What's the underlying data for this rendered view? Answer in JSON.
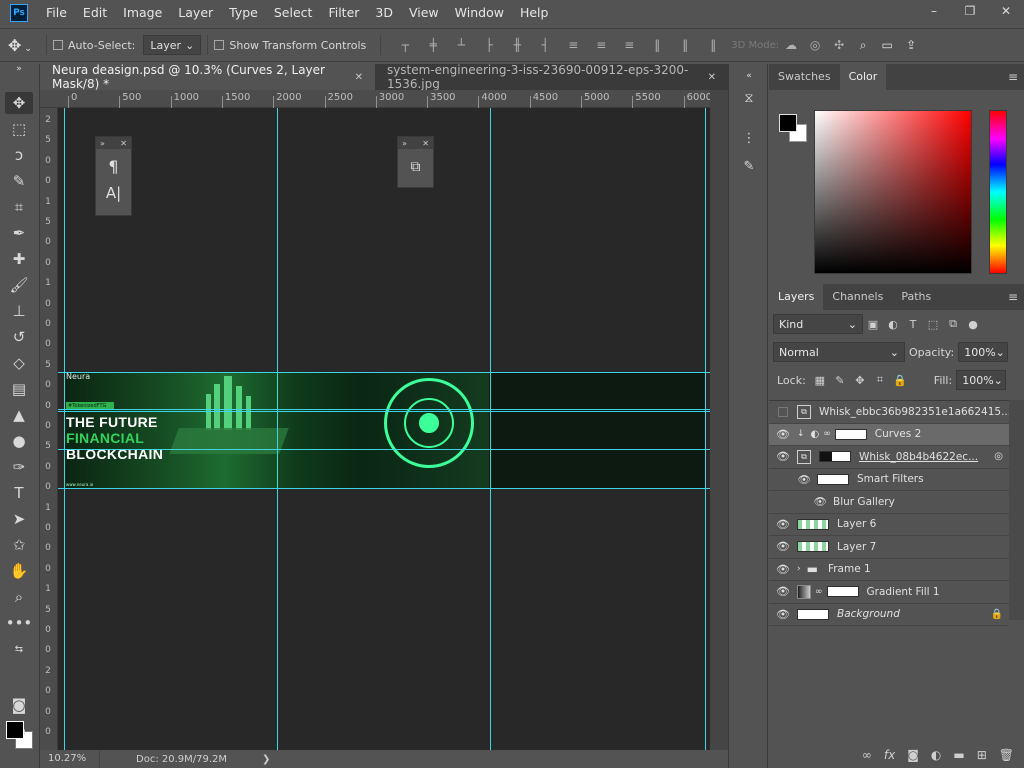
{
  "app": {
    "logo": "Ps"
  },
  "menu": [
    "File",
    "Edit",
    "Image",
    "Layer",
    "Type",
    "Select",
    "Filter",
    "3D",
    "View",
    "Window",
    "Help"
  ],
  "window_controls": {
    "minimize": "–",
    "restore": "❐",
    "close": "✕"
  },
  "options": {
    "auto_select_label": "Auto-Select:",
    "auto_select_value": "Layer",
    "transform_label": "Show Transform Controls",
    "mode_3d": "3D Mode:"
  },
  "tabs": [
    {
      "label": "Neura deasign.psd @ 10.3% (Curves 2, Layer Mask/8) *",
      "close": "✕"
    },
    {
      "label": "system-engineering-3-iss-23690-00912-eps-3200-1536.jpg",
      "close": "✕"
    }
  ],
  "ruler_top": [
    "0",
    "500",
    "1000",
    "1500",
    "2000",
    "2500",
    "3000",
    "3500",
    "4000",
    "4500",
    "5000",
    "5500",
    "6000"
  ],
  "ruler_left": [
    "2",
    "5",
    "0",
    "0",
    "1",
    "5",
    "0",
    "0",
    "1",
    "0",
    "0",
    "0",
    "5",
    "0",
    "0",
    "0",
    "5",
    "0",
    "0",
    "1",
    "0",
    "0",
    "0",
    "1",
    "5",
    "0",
    "0",
    "2",
    "0",
    "0",
    "0"
  ],
  "banner": {
    "logo": "Neura",
    "tag": "#TokenizedFTG",
    "line1": "THE FUTURE",
    "line2": "FINANCIAL",
    "line3": "BLOCKCHAIN",
    "small": "www.neura.io"
  },
  "float_panel_1": {
    "icon1": "¶",
    "icon2": "A|"
  },
  "float_panel_2": {
    "icon": "⧉"
  },
  "status": {
    "zoom": "10.27%",
    "doc": "Doc: 20.9M/79.2M",
    "arrow": "❯"
  },
  "panels": {
    "swatches_tab": "Swatches",
    "color_tab": "Color",
    "layers_tab": "Layers",
    "channels_tab": "Channels",
    "paths_tab": "Paths",
    "kind": "Kind",
    "blend_mode": "Normal",
    "opacity_label": "Opacity:",
    "opacity_value": "100%",
    "lock_label": "Lock:",
    "fill_label": "Fill:",
    "fill_value": "100%"
  },
  "layers": [
    {
      "name": "Whisk_ebbc36b982351e1a662415...",
      "visible": false
    },
    {
      "name": "Curves 2",
      "visible": true,
      "selected": true
    },
    {
      "name": "Whisk_08b4b4622ec...",
      "visible": true
    },
    {
      "name": "Smart Filters",
      "visible": true
    },
    {
      "name": "Blur Gallery",
      "visible": true
    },
    {
      "name": "Layer 6",
      "visible": true
    },
    {
      "name": "Layer 7",
      "visible": true
    },
    {
      "name": "Frame 1",
      "visible": true
    },
    {
      "name": "Gradient Fill 1",
      "visible": true
    },
    {
      "name": "Background",
      "visible": true,
      "locked": true
    }
  ],
  "colors": {
    "guide": "#3fd4e6",
    "accent_green": "#3dff9a"
  }
}
